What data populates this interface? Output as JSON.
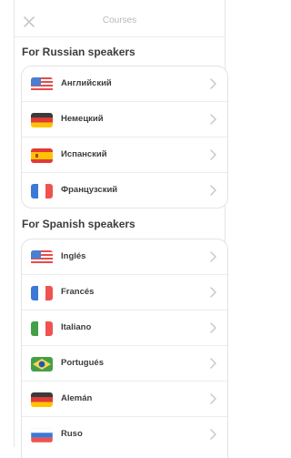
{
  "header": {
    "title": "Courses"
  },
  "sections": [
    {
      "title": "For Russian speakers",
      "items": [
        {
          "label": "Английский",
          "flag": "us"
        },
        {
          "label": "Немецкий",
          "flag": "de"
        },
        {
          "label": "Испанский",
          "flag": "es"
        },
        {
          "label": "Французский",
          "flag": "fr"
        }
      ]
    },
    {
      "title": "For Spanish speakers",
      "items": [
        {
          "label": "Inglés",
          "flag": "us"
        },
        {
          "label": "Francés",
          "flag": "fr"
        },
        {
          "label": "Italiano",
          "flag": "it"
        },
        {
          "label": "Portugués",
          "flag": "br"
        },
        {
          "label": "Alemán",
          "flag": "de"
        },
        {
          "label": "Ruso",
          "flag": "ru"
        }
      ]
    }
  ],
  "icons": {
    "close": "close-icon",
    "chevron": "chevron-right-icon"
  },
  "colors": {
    "text": "#3c3c3c",
    "muted": "#b8b8b8",
    "border": "#e3e3e3"
  }
}
